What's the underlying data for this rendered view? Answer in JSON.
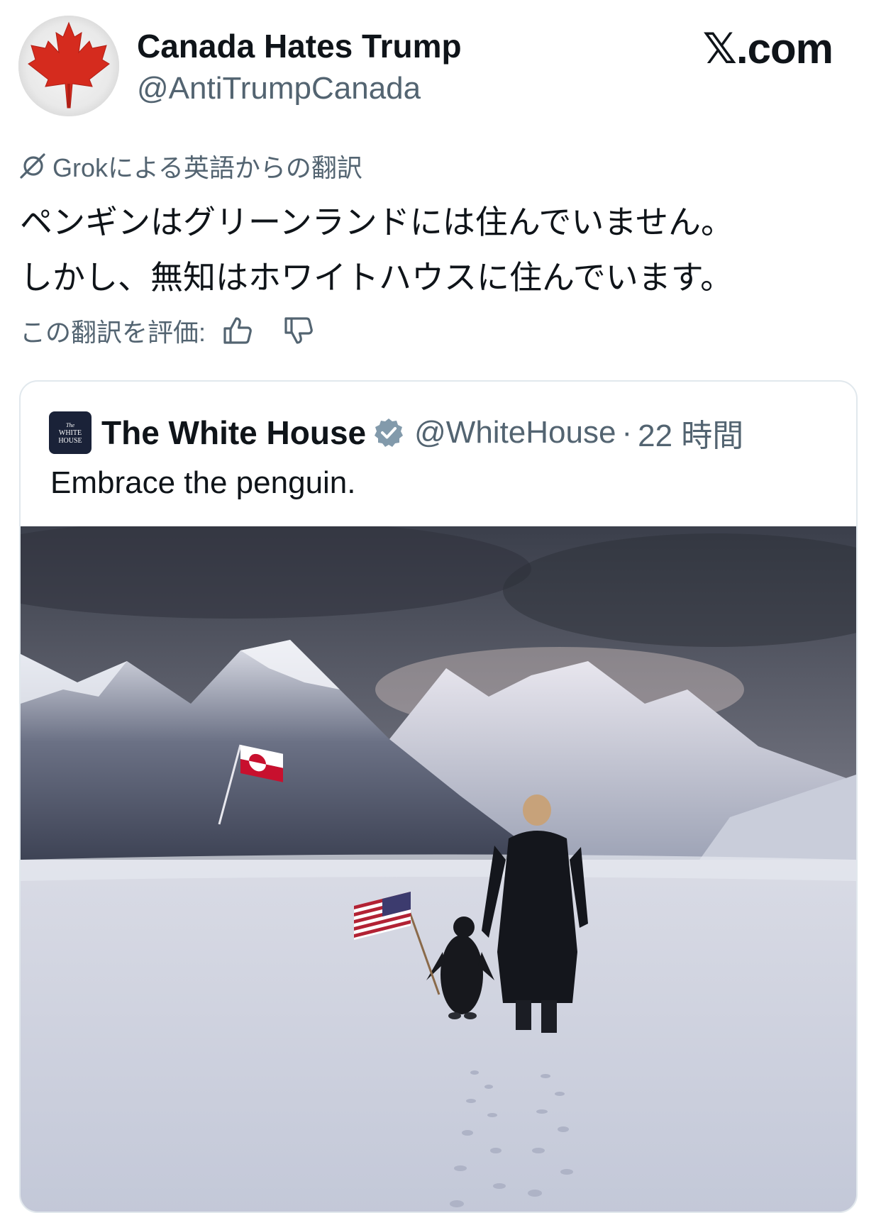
{
  "author": {
    "display_name": "Canada Hates Trump",
    "handle": "@AntiTrumpCanada",
    "avatar_icon": "maple-leaf-icon"
  },
  "brand": {
    "label": "𝕏.com"
  },
  "translation": {
    "note": "Grokによる英語からの翻訳",
    "lines": [
      "ペンギンはグリーンランドには住んでいません。",
      "しかし、無知はホワイトハウスに住んでいます。"
    ],
    "rate_label": "この翻訳を評価:",
    "thumbs_up_icon": "thumbs-up-icon",
    "thumbs_down_icon": "thumbs-down-icon"
  },
  "quoted_post": {
    "avatar_lines": [
      "The",
      "WHITE",
      "HOUSE"
    ],
    "display_name": "The White House",
    "verified_icon": "verified-badge-icon",
    "handle": "@WhiteHouse",
    "separator": "·",
    "time": "22 時間",
    "text": "Embrace the penguin."
  },
  "colors": {
    "text_primary": "#0f1419",
    "text_secondary": "#536471",
    "border": "#e1e8ed",
    "verified_badge": "#829aab",
    "maple_red": "#d52b1e"
  }
}
